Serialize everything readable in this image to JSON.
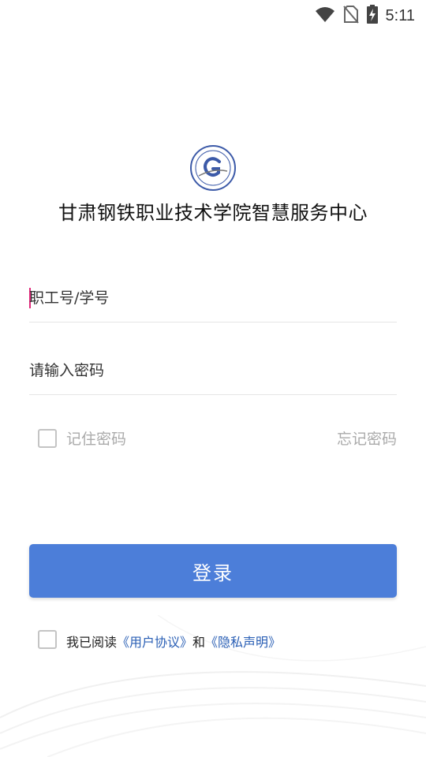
{
  "status_bar": {
    "time": "5:11",
    "icons": [
      "wifi-icon",
      "no-sim-icon",
      "battery-charging-icon"
    ]
  },
  "app": {
    "title": "甘肃钢铁职业技术学院智慧服务中心",
    "logo_icon": "school-emblem-icon"
  },
  "login_form": {
    "username_placeholder": "职工号/学号",
    "username_value": "",
    "password_placeholder": "请输入密码",
    "password_value": "",
    "remember_label": "记住密码",
    "remember_checked": false,
    "forgot_label": "忘记密码",
    "submit_label": "登录"
  },
  "agreement": {
    "prefix": "我已阅读",
    "user_agreement": "《用户协议》",
    "conjunction": "和",
    "privacy_statement": "《隐私声明》",
    "checked": false
  },
  "colors": {
    "primary": "#4c7ed9",
    "link": "#2a5fb5",
    "caret": "#e0297a",
    "muted_text": "#aaaaaa"
  }
}
